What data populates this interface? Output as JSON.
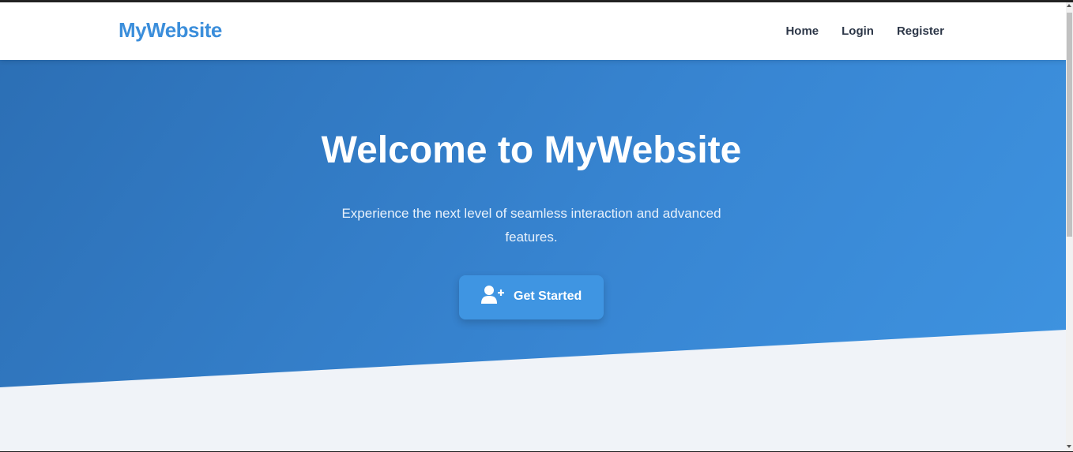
{
  "header": {
    "logo": "MyWebsite",
    "nav": [
      {
        "label": "Home"
      },
      {
        "label": "Login"
      },
      {
        "label": "Register"
      }
    ]
  },
  "hero": {
    "title": "Welcome to MyWebsite",
    "subtitle": "Experience the next level of seamless interaction and advanced features.",
    "cta": {
      "label": "Get Started",
      "icon": "user-plus-icon"
    }
  },
  "colors": {
    "brand": "#3b8edb",
    "hero_start": "#2c6fb5",
    "hero_end": "#3e93e0",
    "button": "#3f95e2",
    "page_bg": "#f0f3f8",
    "nav_text": "#2d3748"
  }
}
